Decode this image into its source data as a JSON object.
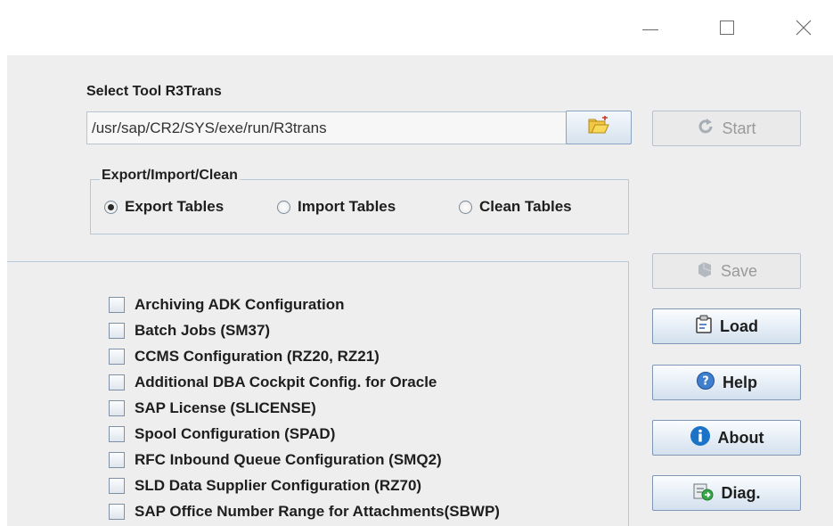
{
  "window": {
    "controls": [
      "minimize-icon",
      "maximize-icon",
      "close-icon"
    ]
  },
  "tool": {
    "label": "Select Tool R3Trans",
    "path": "/usr/sap/CR2/SYS/exe/run/R3trans",
    "browse_icon": "folder-open-icon"
  },
  "mode_group": {
    "title": "Export/Import/Clean",
    "options": [
      {
        "label": "Export Tables",
        "selected": true
      },
      {
        "label": "Import Tables",
        "selected": false
      },
      {
        "label": "Clean Tables",
        "selected": false
      }
    ]
  },
  "buttons": {
    "start": {
      "label": "Start",
      "icon": "refresh-icon",
      "enabled": false
    },
    "save": {
      "label": "Save",
      "icon": "save-icon",
      "enabled": false
    },
    "load": {
      "label": "Load",
      "icon": "clipboard-icon",
      "enabled": true
    },
    "help": {
      "label": "Help",
      "icon": "help-icon",
      "enabled": true
    },
    "about": {
      "label": "About",
      "icon": "info-icon",
      "enabled": true
    },
    "diag": {
      "label": "Diag.",
      "icon": "diagnostics-icon",
      "enabled": true
    }
  },
  "table_groups": [
    {
      "label": "Archiving ADK Configuration",
      "checked": false
    },
    {
      "label": "Batch Jobs (SM37)",
      "checked": false
    },
    {
      "label": "CCMS Configuration (RZ20, RZ21)",
      "checked": false
    },
    {
      "label": "Additional DBA Cockpit Config. for Oracle",
      "checked": false
    },
    {
      "label": "SAP License (SLICENSE)",
      "checked": false
    },
    {
      "label": "Spool Configuration (SPAD)",
      "checked": false
    },
    {
      "label": "RFC Inbound Queue Configuration (SMQ2)",
      "checked": false
    },
    {
      "label": "SLD Data Supplier Configuration (RZ70)",
      "checked": false
    },
    {
      "label": "SAP Office Number Range for Attachments(SBWP)",
      "checked": false
    }
  ],
  "colors": {
    "window_bg": "#eeeeee",
    "border": "#b8c8dc",
    "info_blue": "#1a73c7"
  }
}
